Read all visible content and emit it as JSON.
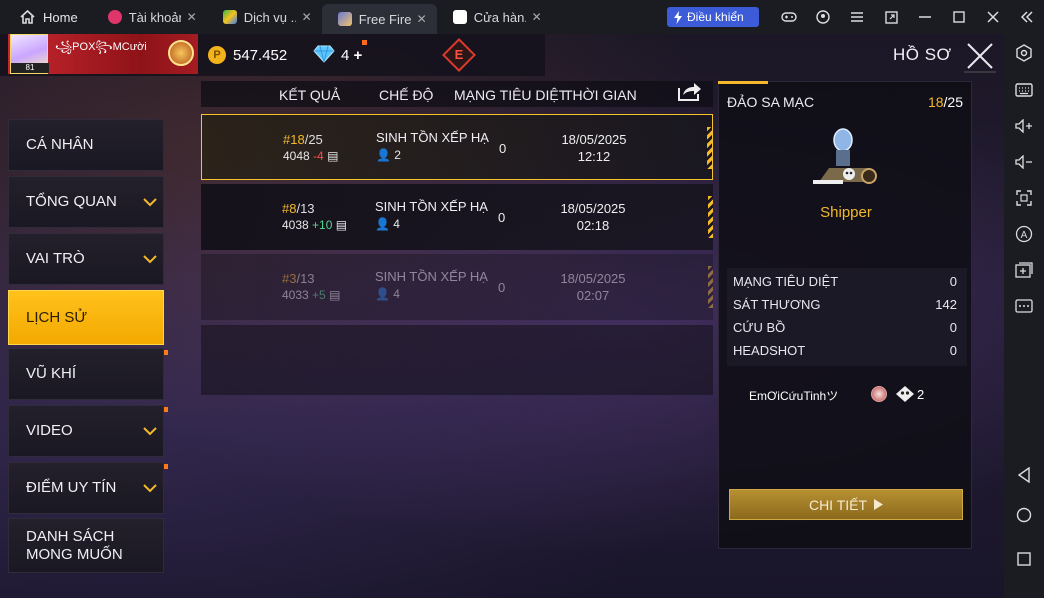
{
  "titlebar": {
    "home_label": "Home",
    "tabs": [
      {
        "label": "Tài khoản",
        "close": "✕",
        "color": "#e0356b"
      },
      {
        "label": "Dịch vụ ...",
        "close": "✕",
        "color": "#39b54a"
      },
      {
        "label": "Free Fire",
        "close": "✕",
        "color": "#6c7ad6"
      },
      {
        "label": "Cửa hàn...",
        "close": "✕",
        "color": "#ffffff"
      }
    ],
    "control_button": "Điều khiển"
  },
  "topbar": {
    "player_name": "꧁POX꧂MCười",
    "avatar_level": "81",
    "gold": "547.452",
    "diamonds": "4",
    "diamond_plus": "+",
    "gold_symbol": "P",
    "elite_badge": "E",
    "page_title": "HỒ SƠ"
  },
  "nav": {
    "items": [
      {
        "label": "CÁ NHÂN"
      },
      {
        "label": "TỔNG QUAN"
      },
      {
        "label": "VAI TRÒ"
      },
      {
        "label": "LỊCH SỬ"
      },
      {
        "label": "VŨ KHÍ"
      },
      {
        "label": "VIDEO"
      },
      {
        "label": "ĐIỂM UY TÍN"
      },
      {
        "label": "DANH SÁCH MONG MUỐN"
      }
    ]
  },
  "table": {
    "headers": [
      "KẾT QUẢ",
      "CHẾ ĐỘ",
      "MẠNG TIÊU DIỆT",
      "THỜI GIAN"
    ],
    "rows": [
      {
        "rank": "#18",
        "total": "/25",
        "score": "4048",
        "delta": "-4",
        "mode": "SINH TỒN XẾP HẠ",
        "team": "2",
        "kills": "0",
        "date": "18/05/2025",
        "time": "12:12"
      },
      {
        "rank": "#8",
        "total": "/13",
        "score": "4038",
        "delta": "+10",
        "mode": "SINH TỒN XẾP HẠ",
        "team": "4",
        "kills": "0",
        "date": "18/05/2025",
        "time": "02:18"
      },
      {
        "rank": "#3",
        "total": "/13",
        "score": "4033",
        "delta": "+5",
        "mode": "SINH TỒN XẾP HẠ",
        "team": "4",
        "kills": "0",
        "date": "18/05/2025",
        "time": "02:07"
      }
    ]
  },
  "detail": {
    "map": "ĐẢO SA MẠC",
    "rank": "18",
    "total": "/25",
    "character": "Shipper",
    "stats": [
      {
        "label": "MẠNG TIÊU DIỆT",
        "value": "0"
      },
      {
        "label": "SÁT THƯƠNG",
        "value": "142"
      },
      {
        "label": "CỨU BỒ",
        "value": "0"
      },
      {
        "label": "HEADSHOT",
        "value": "0"
      }
    ],
    "teammate": "EmƠiCứuTinhツ",
    "teammate_kills": "2",
    "button": "CHI TIẾT"
  }
}
